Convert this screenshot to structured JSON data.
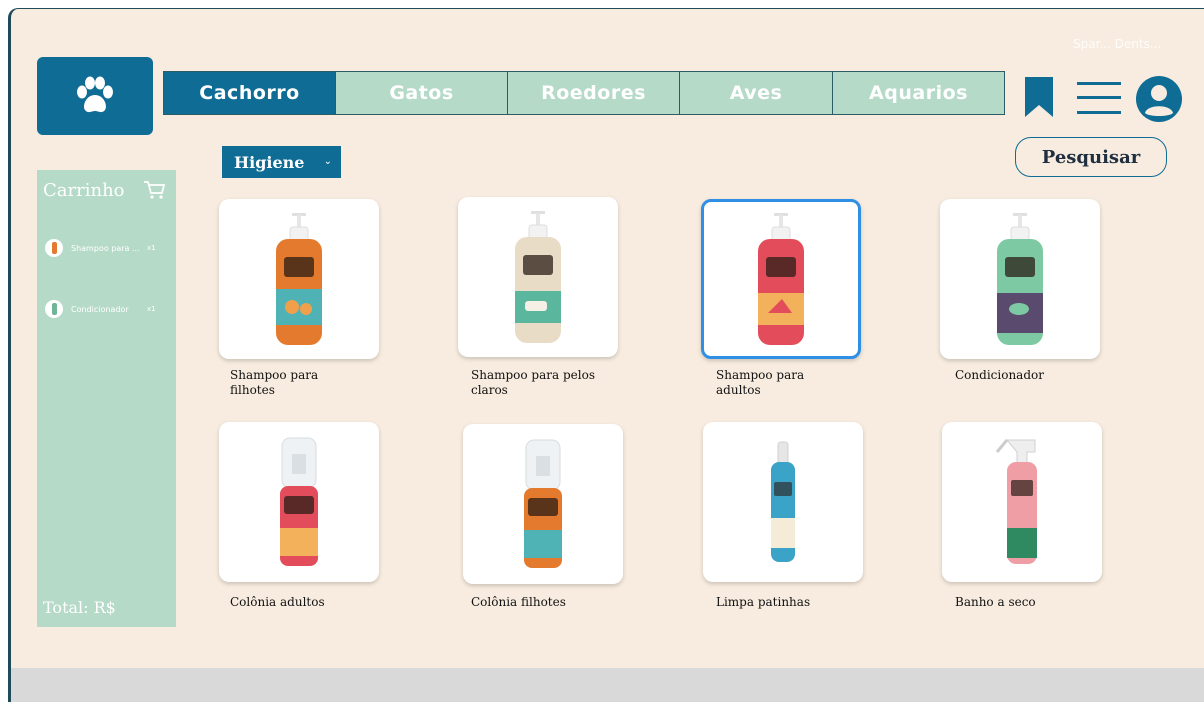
{
  "header": {
    "top_right_faint": "Spar... Dents...",
    "tabs": [
      "Cachorro",
      "Gatos",
      "Roedores",
      "Aves",
      "Aquarios"
    ],
    "active_tab": "Cachorro",
    "search_label": "Pesquisar",
    "icons": [
      "paw-icon",
      "bookmark-icon",
      "menu-icon",
      "user-icon"
    ]
  },
  "filter": {
    "category_selected": "Higiene"
  },
  "cart": {
    "title": "Carrinho",
    "items": [
      {
        "name": "Shampoo para ...",
        "qty": "x1"
      },
      {
        "name": "Condicionador",
        "qty": "x1"
      }
    ],
    "total_label": "Total: R$"
  },
  "products": [
    {
      "name": "Shampoo para filhotes"
    },
    {
      "name": "Shampoo para pelos claros"
    },
    {
      "name": "Shampoo para adultos"
    },
    {
      "name": "Condicionador"
    },
    {
      "name": "Colônia adultos"
    },
    {
      "name": "Colônia filhotes"
    },
    {
      "name": "Limpa patinhas"
    },
    {
      "name": "Banho a seco"
    }
  ],
  "colors": {
    "primary": "#0f6c95",
    "mint": "#b5dac8",
    "background": "#f7ecdf",
    "selection": "#2f8fe4"
  }
}
